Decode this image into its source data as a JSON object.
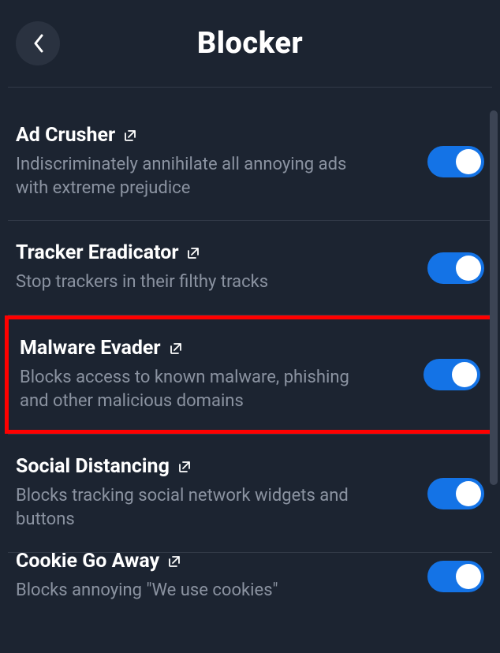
{
  "header": {
    "title": "Blocker"
  },
  "items": [
    {
      "title": "Ad Crusher",
      "desc": "Indiscriminately annihilate all annoying ads with extreme prejudice",
      "on": true,
      "highlighted": false
    },
    {
      "title": "Tracker Eradicator",
      "desc": "Stop trackers in their filthy tracks",
      "on": true,
      "highlighted": false
    },
    {
      "title": "Malware Evader",
      "desc": "Blocks access to known malware, phishing and other malicious domains",
      "on": true,
      "highlighted": true
    },
    {
      "title": "Social Distancing",
      "desc": "Blocks tracking social network widgets and buttons",
      "on": true,
      "highlighted": false
    },
    {
      "title": "Cookie Go Away",
      "desc": "Blocks annoying \"We use cookies\"",
      "on": true,
      "highlighted": false
    }
  ],
  "colors": {
    "bg": "#1c2431",
    "accent": "#1473e6",
    "muted": "#8b93a1",
    "highlight": "#ff0000"
  }
}
